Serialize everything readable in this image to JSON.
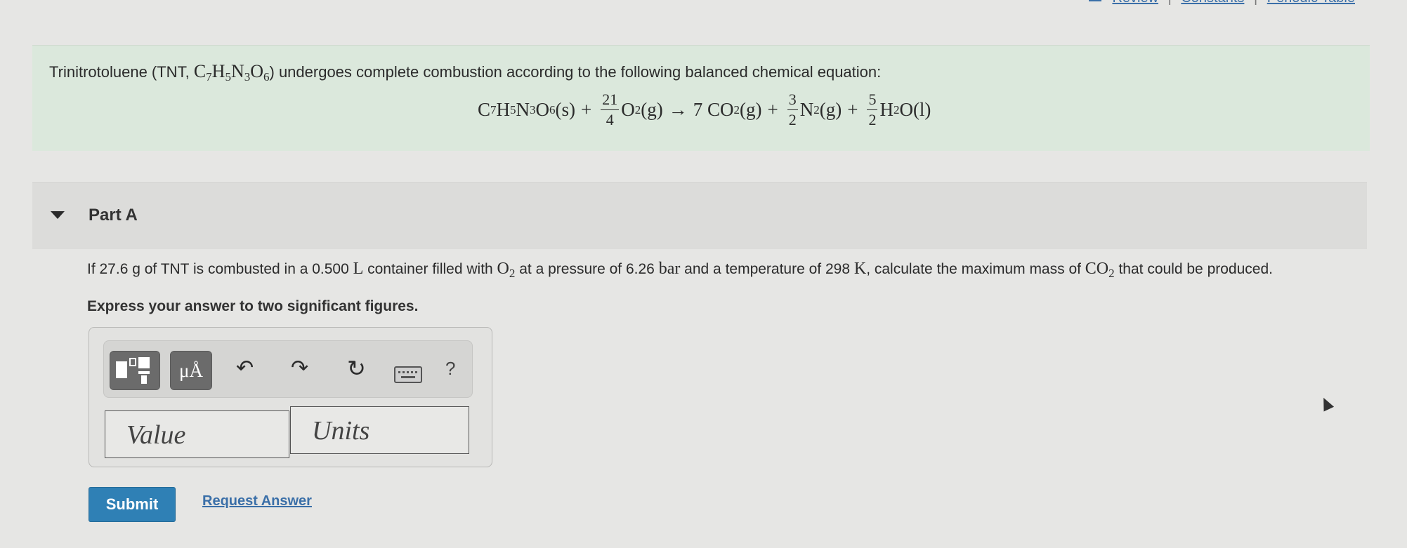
{
  "top_links": {
    "review": "Review",
    "constants": "Constants",
    "periodic_table": "Periodic Table",
    "sep": "|"
  },
  "intro": {
    "text_before": "Trinitrotoluene (TNT, ",
    "formula": {
      "c": "C",
      "c_n": "7",
      "h": "H",
      "h_n": "5",
      "n": "N",
      "n_n": "3",
      "o": "O",
      "o_n": "6"
    },
    "text_after": ") undergoes complete combustion according to the following balanced chemical equation:"
  },
  "equation": {
    "reactant": {
      "c": "C",
      "c_n": "7",
      "h": "H",
      "h_n": "5",
      "n": "N",
      "n_n": "3",
      "o": "O",
      "o_n": "6",
      "state": "(s)"
    },
    "plus": "+",
    "o2_coef_num": "21",
    "o2_coef_den": "4",
    "o2": "O",
    "o2_n": "2",
    "o2_state": "(g)",
    "arrow": "→",
    "co2_coef": "7",
    "co2": "CO",
    "co2_n": "2",
    "co2_state": "(g)",
    "n2_coef_num": "3",
    "n2_coef_den": "2",
    "n2": "N",
    "n2_n": "2",
    "n2_state": "(g)",
    "h2o_coef_num": "5",
    "h2o_coef_den": "2",
    "h2o_h": "H",
    "h2o_n": "2",
    "h2o_o": "O",
    "h2o_state": "(l)"
  },
  "part": {
    "title": "Part A"
  },
  "question": {
    "t1": "If 27.6 g of TNT is combusted in a 0.500 ",
    "unit_l": "L",
    "t2": " container filled with ",
    "o2": "O",
    "o2_n": "2",
    "t3": " at a pressure of 6.26 ",
    "unit_bar": "bar",
    "t4": " and a temperature of 298 ",
    "unit_k": "K",
    "t5": ", calculate the maximum mass of ",
    "co2": "CO",
    "co2_n": "2",
    "t6": " that could be produced.",
    "instruction": "Express your answer to two significant figures."
  },
  "toolbar": {
    "units_label": "μÅ",
    "undo": "↶",
    "redo": "↷",
    "reset": "↻",
    "help": "?"
  },
  "answer": {
    "value_placeholder": "Value",
    "units_placeholder": "Units"
  },
  "actions": {
    "submit": "Submit",
    "request_answer": "Request Answer"
  },
  "colors": {
    "intro_bg": "#dbe8dc",
    "submit_bg": "#2f80b5",
    "link": "#3a6fa8"
  }
}
